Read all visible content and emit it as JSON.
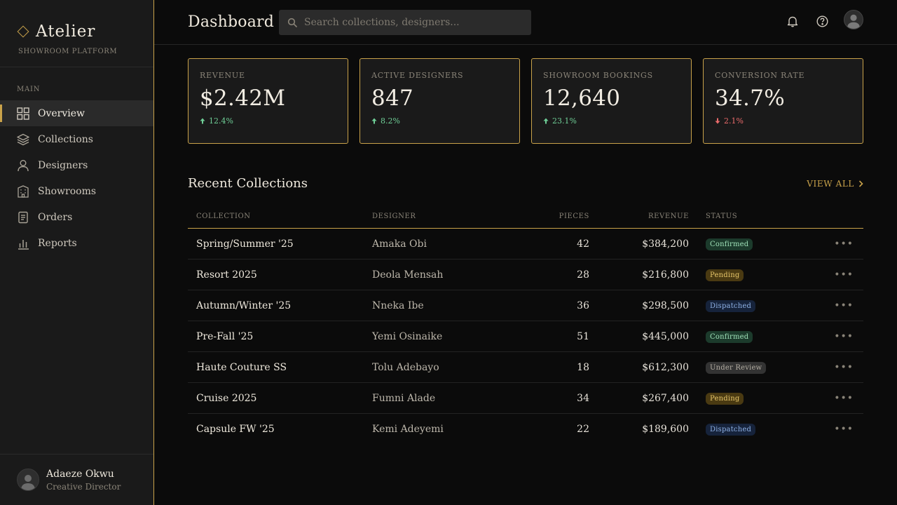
{
  "brand": {
    "name": "Atelier",
    "subtitle": "SHOWROOM PLATFORM"
  },
  "sidebar": {
    "section": "MAIN",
    "items": [
      {
        "label": "Overview",
        "icon": "grid-icon",
        "active": true
      },
      {
        "label": "Collections",
        "icon": "layers-icon",
        "active": false
      },
      {
        "label": "Designers",
        "icon": "user-icon",
        "active": false
      },
      {
        "label": "Showrooms",
        "icon": "building-icon",
        "active": false
      },
      {
        "label": "Orders",
        "icon": "document-icon",
        "active": false
      },
      {
        "label": "Reports",
        "icon": "bar-chart-icon",
        "active": false
      }
    ],
    "user": {
      "name": "Adaeze Okwu",
      "role": "Creative Director"
    }
  },
  "header": {
    "title": "Dashboard",
    "search_placeholder": "Search collections, designers..."
  },
  "stats": [
    {
      "label": "REVENUE",
      "value": "$2.42M",
      "delta": "12.4%",
      "direction": "up"
    },
    {
      "label": "ACTIVE DESIGNERS",
      "value": "847",
      "delta": "8.2%",
      "direction": "up"
    },
    {
      "label": "SHOWROOM BOOKINGS",
      "value": "12,640",
      "delta": "23.1%",
      "direction": "up"
    },
    {
      "label": "CONVERSION RATE",
      "value": "34.7%",
      "delta": "2.1%",
      "direction": "down"
    }
  ],
  "recent": {
    "title": "Recent Collections",
    "view_all": "VIEW ALL",
    "columns": {
      "collection": "COLLECTION",
      "designer": "DESIGNER",
      "pieces": "PIECES",
      "revenue": "REVENUE",
      "status": "STATUS"
    },
    "rows": [
      {
        "collection": "Spring/Summer '25",
        "designer": "Amaka Obi",
        "pieces": "42",
        "revenue": "$384,200",
        "status": "Confirmed"
      },
      {
        "collection": "Resort 2025",
        "designer": "Deola Mensah",
        "pieces": "28",
        "revenue": "$216,800",
        "status": "Pending"
      },
      {
        "collection": "Autumn/Winter '25",
        "designer": "Nneka Ibe",
        "pieces": "36",
        "revenue": "$298,500",
        "status": "Dispatched"
      },
      {
        "collection": "Pre-Fall '25",
        "designer": "Yemi Osinaike",
        "pieces": "51",
        "revenue": "$445,000",
        "status": "Confirmed"
      },
      {
        "collection": "Haute Couture SS",
        "designer": "Tolu Adebayo",
        "pieces": "18",
        "revenue": "$612,300",
        "status": "Under Review"
      },
      {
        "collection": "Cruise 2025",
        "designer": "Fumni Alade",
        "pieces": "34",
        "revenue": "$267,400",
        "status": "Pending"
      },
      {
        "collection": "Capsule FW '25",
        "designer": "Kemi Adeyemi",
        "pieces": "22",
        "revenue": "$189,600",
        "status": "Dispatched"
      }
    ]
  },
  "colors": {
    "accent": "#c9a24a",
    "up": "#6fcf97",
    "down": "#eb6b6b"
  }
}
